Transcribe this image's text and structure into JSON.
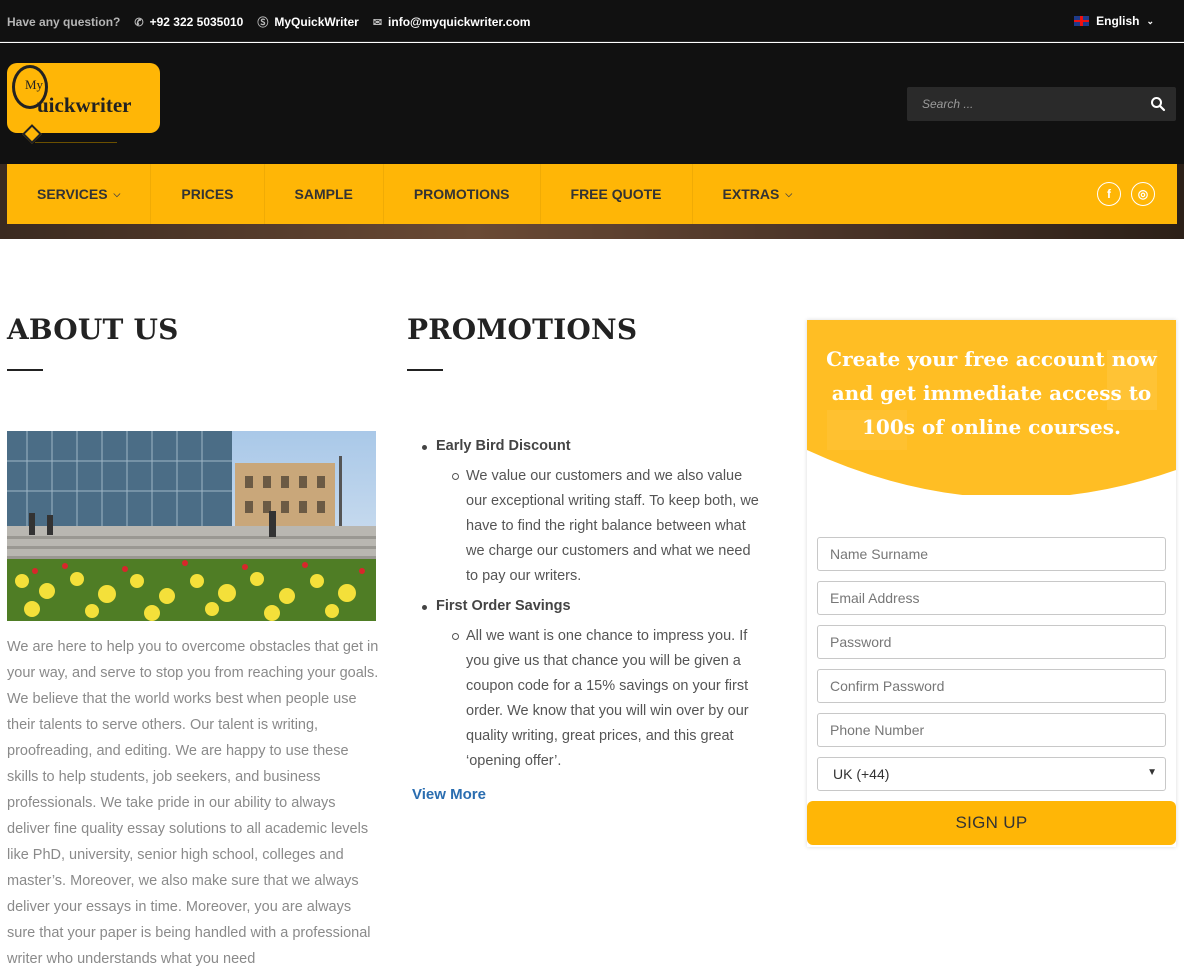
{
  "topbar": {
    "question": "Have any question?",
    "phone": "+92 322 5035010",
    "skype": "MyQuickWriter",
    "email": "info@myquickwriter.com",
    "language": "English"
  },
  "header": {
    "logo_small": "My",
    "logo_word": "uickwriter",
    "search_placeholder": "Search ..."
  },
  "nav": {
    "items": [
      {
        "label": "SERVICES",
        "dropdown": true
      },
      {
        "label": "PRICES"
      },
      {
        "label": "SAMPLE"
      },
      {
        "label": "PROMOTIONS"
      },
      {
        "label": "FREE QUOTE"
      },
      {
        "label": "EXTRAS",
        "dropdown": true
      }
    ],
    "social": {
      "facebook": "f",
      "instagram": "◎"
    }
  },
  "about": {
    "title": "ABOUT US",
    "text": "We are here to help you to overcome obstacles that get in your way, and serve to stop you from reaching your goals. We believe that the world works best when people use their talents to serve others. Our talent is writing, proofreading, and editing. We are happy to use these skills to help students, job seekers, and business professionals. We take pride in our ability to always deliver fine quality essay solutions to all academic levels like PhD, university, senior high school, colleges and master’s. Moreover, we also make sure that we always deliver your essays in time. Moreover, you are always sure that your paper is being handled with a professional writer who understands what you need"
  },
  "promotions": {
    "title": "PROMOTIONS",
    "items": [
      {
        "heading": "Early Bird Discount",
        "text": "We value our customers and we also value our exceptional writing staff. To keep both, we have to find the right balance between what we charge our customers and what we need to pay our writers."
      },
      {
        "heading": "First Order Savings",
        "text": "All we want is one chance to impress you. If you give us that chance you will be given a coupon code for a 15% savings on your first order. We know that you will win over by our quality writing, great prices, and this great ‘opening offer’."
      }
    ],
    "view_more": "View More"
  },
  "signup": {
    "headline": "Create your free account now and get immediate access to 100s of online courses.",
    "fields": {
      "name": "Name Surname",
      "email": "Email Address",
      "password": "Password",
      "confirm": "Confirm Password",
      "phone": "Phone Number"
    },
    "country": "UK (+44)",
    "button": "SIGN UP"
  },
  "colors": {
    "accent": "#ffb606",
    "dark": "#111111",
    "link": "#2a6db0"
  }
}
